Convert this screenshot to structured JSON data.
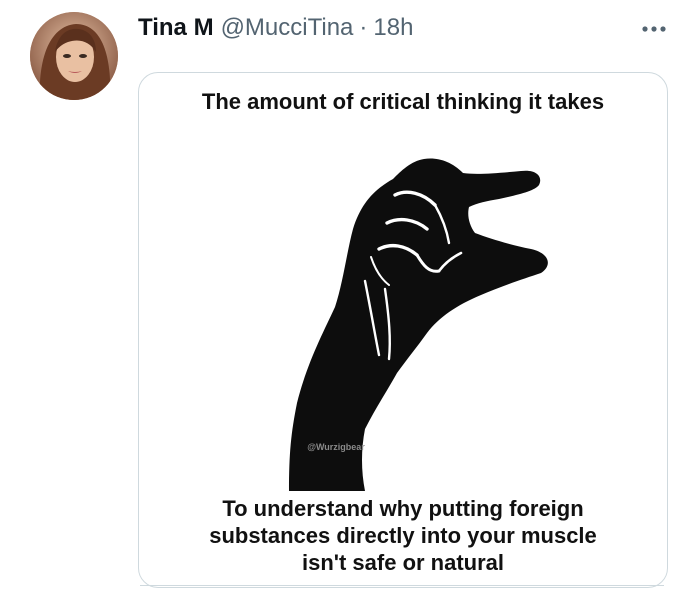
{
  "tweet": {
    "display_name": "Tina M",
    "handle": "@MucciTina",
    "separator": "·",
    "time": "18h",
    "more_icon": "more-horizontal-icon"
  },
  "image": {
    "top_text": "The amount of critical thinking it takes",
    "watermark": "@Wurzigbear",
    "bottom_text": "To understand why putting foreign\nsubstances directly into your muscle\nisn't safe or natural"
  },
  "colors": {
    "name": "#0f1419",
    "secondary": "#536471",
    "border": "#cfd9de",
    "hand": "#0d0d0d"
  }
}
